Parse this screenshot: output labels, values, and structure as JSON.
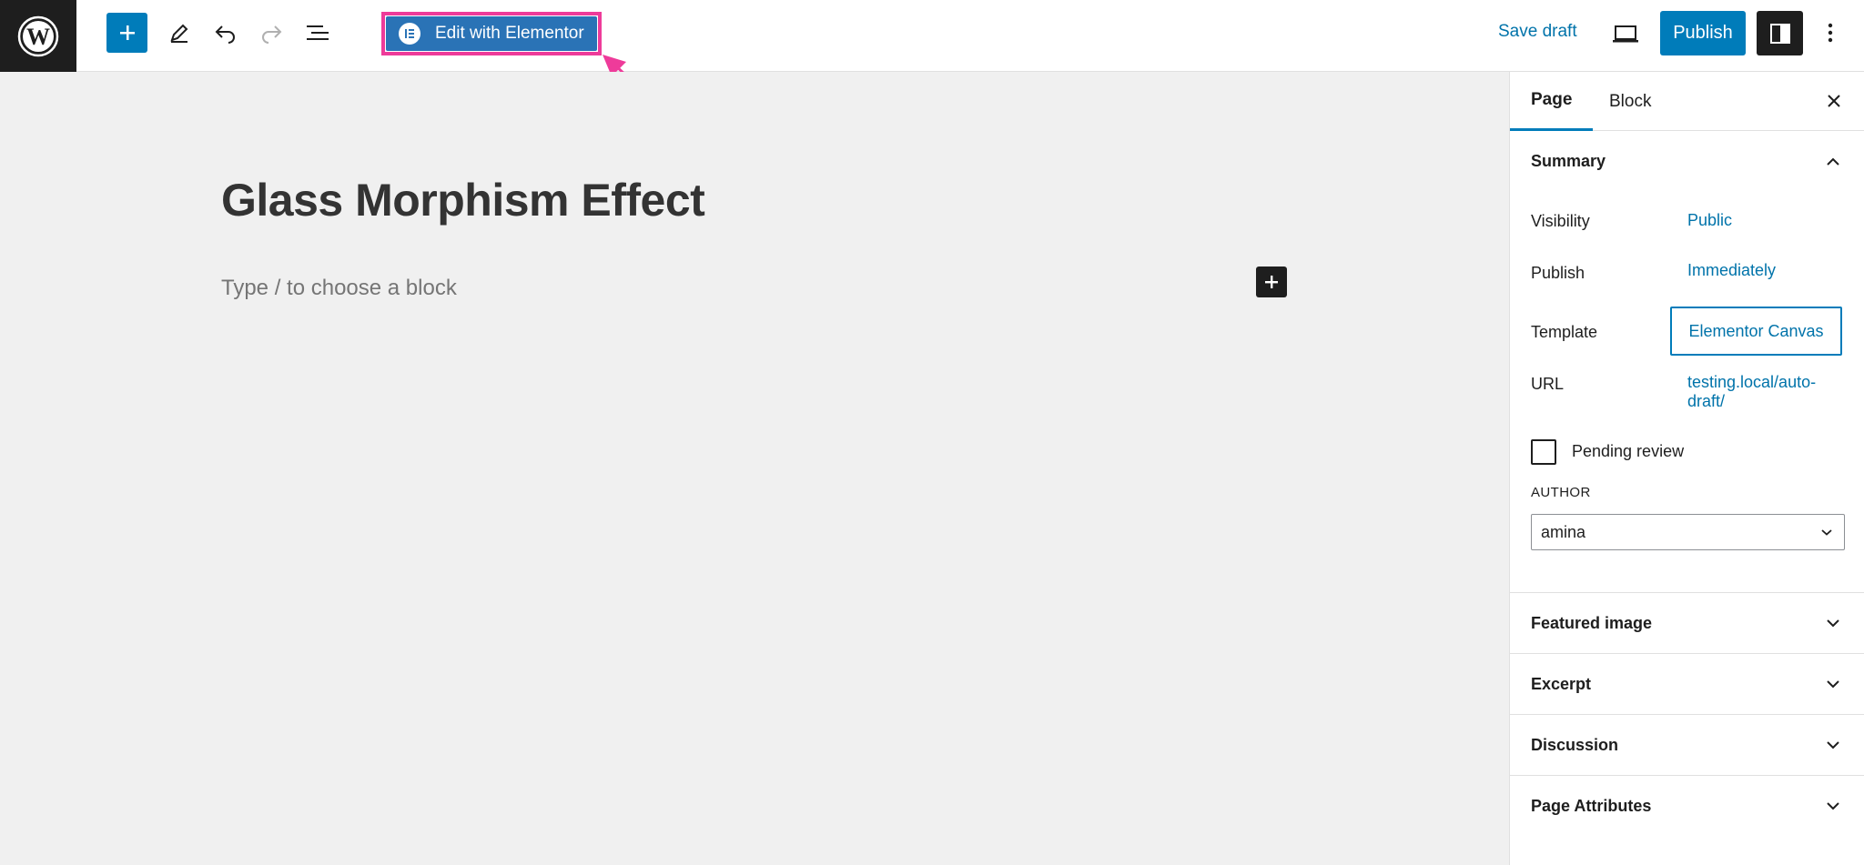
{
  "toolbar": {
    "elementor_label": "Edit with Elementor",
    "save_draft": "Save draft",
    "publish": "Publish"
  },
  "editor": {
    "title": "Glass Morphism Effect",
    "placeholder": "Type / to choose a block"
  },
  "sidebar": {
    "tabs": [
      "Page",
      "Block"
    ],
    "summary": {
      "heading": "Summary",
      "visibility_label": "Visibility",
      "visibility_value": "Public",
      "publish_label": "Publish",
      "publish_value": "Immediately",
      "template_label": "Template",
      "template_value": "Elementor Canvas",
      "url_label": "URL",
      "url_value_line1": "testing.local/auto-",
      "url_value_line2": "draft/",
      "pending_review": "Pending review",
      "author_label": "AUTHOR",
      "author_value": "amina"
    },
    "panels": [
      "Featured image",
      "Excerpt",
      "Discussion",
      "Page Attributes"
    ]
  },
  "colors": {
    "accent": "#007cba",
    "highlight": "#ee3b9a",
    "dark": "#1e1e1e",
    "link": "#0073aa"
  },
  "icons": [
    "wordpress-logo-icon",
    "plus-icon",
    "pencil-icon",
    "undo-icon",
    "redo-icon",
    "list-view-icon",
    "elementor-icon",
    "desktop-preview-icon",
    "sidebar-settings-icon",
    "more-options-icon",
    "close-icon",
    "chevron-up-icon",
    "chevron-down-icon"
  ]
}
